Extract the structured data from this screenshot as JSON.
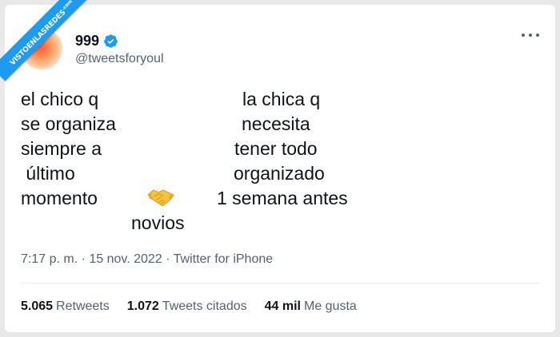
{
  "watermark": {
    "main": "VISTOENLASREDES",
    "suffix": ".com"
  },
  "author": {
    "display_name": "999",
    "handle": "@tweetsforyoul"
  },
  "tweet": {
    "left_lines": [
      "el chico q",
      "se organiza",
      "siempre a",
      " último",
      "momento"
    ],
    "right_lines": [
      "la chica q",
      "necesita",
      "tener todo",
      "organizado",
      "1 semana antes"
    ],
    "center_label": "novios",
    "emoji_icon": "handshake-icon"
  },
  "meta": {
    "timestamp": "7:17 p. m. · 15 nov. 2022 · Twitter for iPhone"
  },
  "stats": [
    {
      "count": "5.065",
      "label": "Retweets"
    },
    {
      "count": "1.072",
      "label": "Tweets citados"
    },
    {
      "count": "44 mil",
      "label": "Me gusta"
    }
  ],
  "colors": {
    "accent": "#1d9bf0",
    "text": "#0f1419",
    "secondary": "#536471"
  }
}
